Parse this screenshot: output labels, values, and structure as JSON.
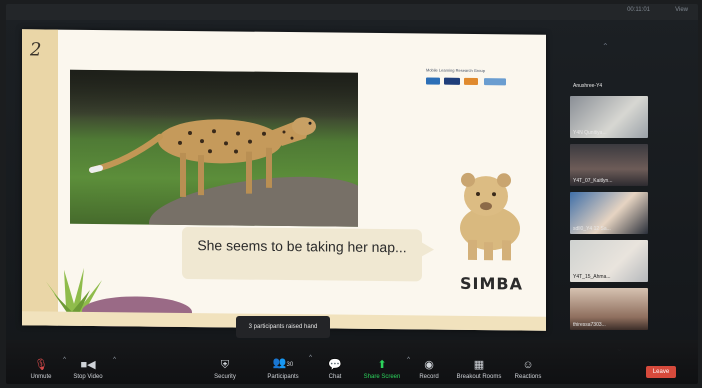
{
  "top_bar": {
    "info_text": "00:11:01",
    "view_label": "View"
  },
  "slide": {
    "number": "2",
    "org_text": "Mobile Learning Research Group",
    "caption": "She seems to be taking her nap...",
    "lion_name": "SIMBA"
  },
  "participants": [
    {
      "name": "Anushree-Y4"
    },
    {
      "name": "Y4N Qunitiya..."
    },
    {
      "name": "Y4T_07_Kaitlyn..."
    },
    {
      "name": "sdll0_Y4 12 Sa..."
    },
    {
      "name": "Y4T_15_Ahma..."
    },
    {
      "name": "thiressa7303..."
    }
  ],
  "toast": {
    "text": "3 participants raised hand"
  },
  "toolbar": {
    "unmute": "Unmute",
    "stop_video": "Stop Video",
    "security": "Security",
    "participants": "Participants",
    "participants_count": "30",
    "chat": "Chat",
    "share_screen": "Share Screen",
    "record": "Record",
    "breakout_rooms": "Breakout Rooms",
    "reactions": "Reactions",
    "leave": "Leave"
  },
  "colors": {
    "slide_bg": "#fbf7ee",
    "slide_band": "#ead6a7",
    "share_green": "#2cd25c",
    "leave_red": "#d64a3c"
  }
}
